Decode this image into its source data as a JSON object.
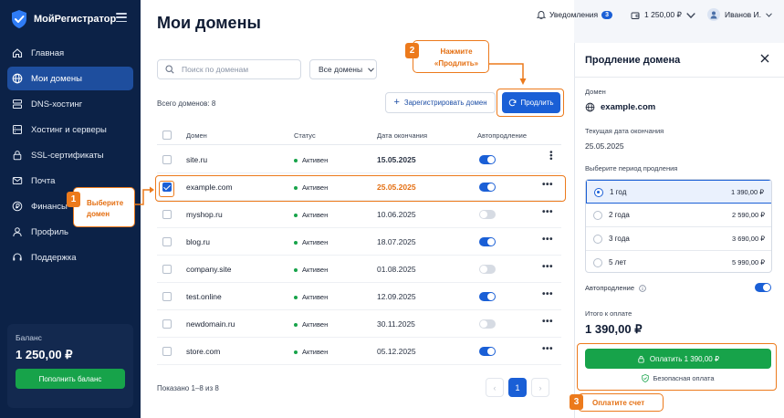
{
  "app": {
    "name": "МойРегистратор"
  },
  "sidebar": {
    "items": [
      {
        "label": "Главная",
        "icon": "home-icon"
      },
      {
        "label": "Мои домены",
        "icon": "globe-icon",
        "active": true
      },
      {
        "label": "DNS-хостинг",
        "icon": "dns-icon"
      },
      {
        "label": "Хостинг и серверы",
        "icon": "server-icon"
      },
      {
        "label": "SSL-сертификаты",
        "icon": "lock-icon"
      },
      {
        "label": "Почта",
        "icon": "mail-icon"
      },
      {
        "label": "Финансы",
        "icon": "finance-icon"
      },
      {
        "label": "Профиль",
        "icon": "user-icon"
      },
      {
        "label": "Поддержка",
        "icon": "headset-icon"
      }
    ],
    "balance": {
      "label": "Баланс",
      "value": "1 250,00 ₽",
      "button": "Пополнить баланс"
    }
  },
  "header": {
    "notifications_label": "Уведомления",
    "notifications_count": "3",
    "wallet": "1 250,00 ₽",
    "user": "Иванов И."
  },
  "main": {
    "title": "Мои домены",
    "search_placeholder": "Поиск по доменам",
    "filter": "Все домены",
    "total": "Всего доменов: 8",
    "register_button": "Зарегистрировать домен",
    "renew_button": "Продлить",
    "columns": [
      "Домен",
      "Статус",
      "Дата окончания",
      "Автопродление"
    ],
    "rows": [
      {
        "domain": "site.ru",
        "status": "Активен",
        "date": "15.05.2025",
        "auto": true,
        "checked": false
      },
      {
        "domain": "example.com",
        "status": "Активен",
        "date": "25.05.2025",
        "auto": true,
        "checked": true
      },
      {
        "domain": "myshop.ru",
        "status": "Активен",
        "date": "10.06.2025",
        "auto": false,
        "checked": false
      },
      {
        "domain": "blog.ru",
        "status": "Активен",
        "date": "18.07.2025",
        "auto": true,
        "checked": false
      },
      {
        "domain": "company.site",
        "status": "Активен",
        "date": "01.08.2025",
        "auto": false,
        "checked": false
      },
      {
        "domain": "test.online",
        "status": "Активен",
        "date": "12.09.2025",
        "auto": true,
        "checked": false
      },
      {
        "domain": "newdomain.ru",
        "status": "Активен",
        "date": "30.11.2025",
        "auto": false,
        "checked": false
      },
      {
        "domain": "store.com",
        "status": "Активен",
        "date": "05.12.2025",
        "auto": true,
        "checked": false
      }
    ],
    "shown": "Показано 1–8 из 8",
    "pagination": {
      "prev": "‹",
      "page": "1",
      "next": "›"
    }
  },
  "panel": {
    "title": "Продление домена",
    "domain_label": "Домен",
    "domain": "example.com",
    "date_label": "Текущая дата окончания",
    "date": "25.05.2025",
    "period_label": "Выберите период продления",
    "periods": [
      {
        "name": "1 год",
        "price": "1 390,00 ₽",
        "selected": true
      },
      {
        "name": "2 года",
        "price": "2 590,00 ₽",
        "selected": false
      },
      {
        "name": "3 года",
        "price": "3 690,00 ₽",
        "selected": false
      },
      {
        "name": "5 лет",
        "price": "5 990,00 ₽",
        "selected": false
      }
    ],
    "auto_label": "Автопродление",
    "total_label": "Итого к оплате",
    "total": "1 390,00 ₽",
    "pay_button": "Оплатить 1 390,00 ₽",
    "secure": "Безопасная оплата"
  },
  "callouts": {
    "step1": {
      "num": "1",
      "text": "Выберите домен"
    },
    "step2": {
      "num": "2",
      "text": "Нажмите «Продлить»"
    },
    "step3": {
      "num": "3",
      "text": "Оплатите счет"
    }
  },
  "colors": {
    "accent": "#1a5fd6",
    "highlight": "#ec7a1c",
    "success": "#17a34a",
    "sidebar": "#0c2247"
  }
}
